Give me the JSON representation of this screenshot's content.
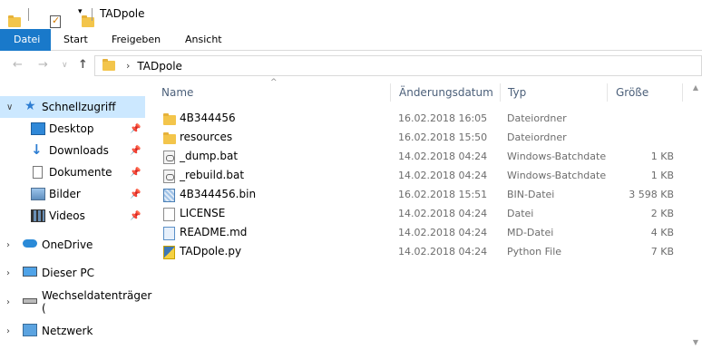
{
  "window": {
    "title": "TADpole"
  },
  "quick_access_toolbar": {
    "icons": [
      "folder-icon",
      "properties-icon",
      "new-folder-icon",
      "dropdown-arrow-icon"
    ]
  },
  "ribbon": {
    "tabs": [
      {
        "label": "Datei",
        "active": true
      },
      {
        "label": "Start"
      },
      {
        "label": "Freigeben"
      },
      {
        "label": "Ansicht"
      }
    ]
  },
  "address_bar": {
    "crumbs": [
      "TADpole"
    ],
    "back_icon": "back-arrow-icon",
    "forward_icon": "forward-arrow-icon",
    "recent_icon": "chevron-down-icon",
    "up_icon": "up-arrow-icon"
  },
  "sidebar": {
    "items": [
      {
        "label": "Schnellzugriff",
        "icon": "star-icon",
        "selected": true,
        "expanded": true
      },
      {
        "label": "Desktop",
        "icon": "desktop-icon",
        "pinned": true
      },
      {
        "label": "Downloads",
        "icon": "download-icon",
        "pinned": true
      },
      {
        "label": "Dokumente",
        "icon": "document-icon",
        "pinned": true
      },
      {
        "label": "Bilder",
        "icon": "pictures-icon",
        "pinned": true
      },
      {
        "label": "Videos",
        "icon": "video-icon",
        "pinned": true
      },
      {
        "label": "OneDrive",
        "icon": "cloud-icon"
      },
      {
        "label": "Dieser PC",
        "icon": "computer-icon"
      },
      {
        "label": "Wechseldatenträger (",
        "icon": "drive-icon"
      },
      {
        "label": "Netzwerk",
        "icon": "network-icon"
      }
    ]
  },
  "file_list": {
    "columns": [
      "Name",
      "Änderungsdatum",
      "Typ",
      "Größe"
    ],
    "sort_indicator": "^",
    "rows": [
      {
        "name": "4B344456",
        "date": "16.02.2018 16:05",
        "type": "Dateiordner",
        "size": "",
        "icon": "folder-icon"
      },
      {
        "name": "resources",
        "date": "16.02.2018 15:50",
        "type": "Dateiordner",
        "size": "",
        "icon": "folder-icon"
      },
      {
        "name": "_dump.bat",
        "date": "14.02.2018 04:24",
        "type": "Windows-Batchdatei",
        "size": "1 KB",
        "icon": "batch-file-icon"
      },
      {
        "name": "_rebuild.bat",
        "date": "14.02.2018 04:24",
        "type": "Windows-Batchdatei",
        "size": "1 KB",
        "icon": "batch-file-icon"
      },
      {
        "name": "4B344456.bin",
        "date": "16.02.2018 15:51",
        "type": "BIN-Datei",
        "size": "3 598 KB",
        "icon": "binary-file-icon"
      },
      {
        "name": "LICENSE",
        "date": "14.02.2018 04:24",
        "type": "Datei",
        "size": "2 KB",
        "icon": "file-icon"
      },
      {
        "name": "README.md",
        "date": "14.02.2018 04:24",
        "type": "MD-Datei",
        "size": "4 KB",
        "icon": "markdown-file-icon"
      },
      {
        "name": "TADpole.py",
        "date": "14.02.2018 04:24",
        "type": "Python File",
        "size": "7 KB",
        "icon": "python-file-icon"
      }
    ]
  },
  "colors": {
    "accent": "#1979ca",
    "selection": "#cce8ff",
    "folder": "#f3c54b",
    "header_text": "#4c607a"
  }
}
